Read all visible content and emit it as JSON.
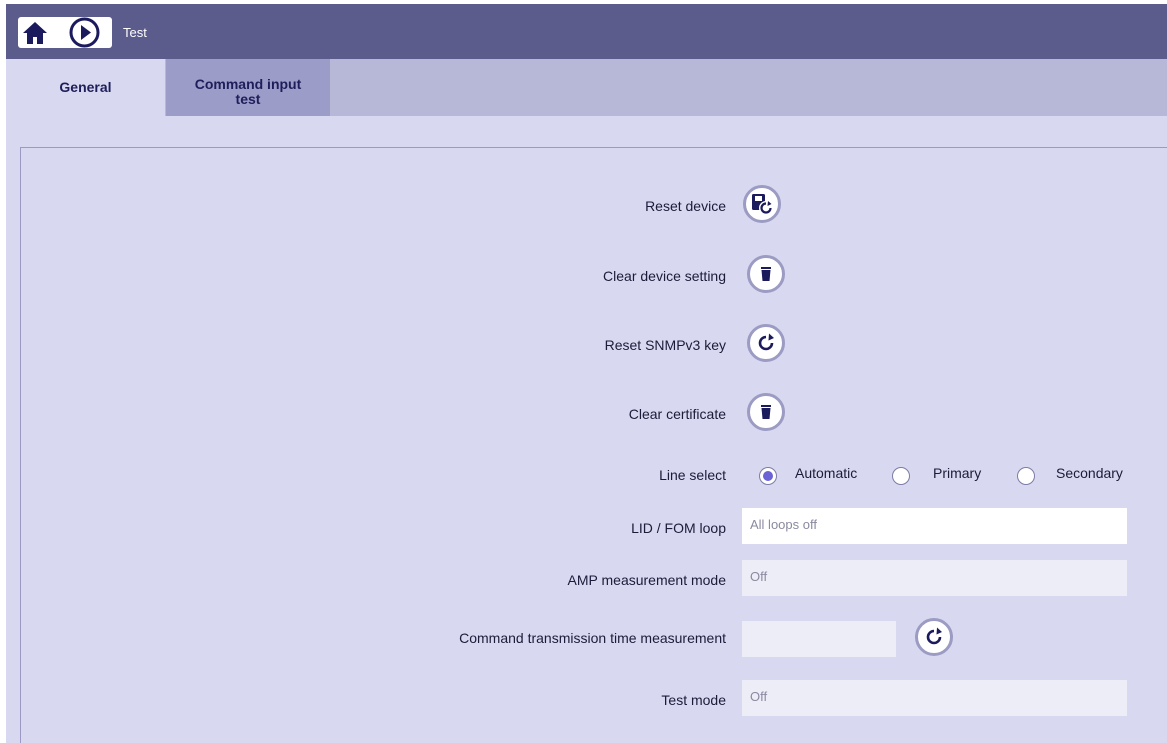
{
  "header": {
    "title": "Test"
  },
  "tabs": [
    {
      "label": "General"
    },
    {
      "label_line1": "Command input",
      "label_line2": "test"
    }
  ],
  "rows": {
    "reset_device": {
      "label": "Reset device"
    },
    "clear_device_setting": {
      "label": "Clear device setting"
    },
    "reset_snmpv3": {
      "label": "Reset SNMPv3 key"
    },
    "clear_certificate": {
      "label": "Clear certificate"
    },
    "line_select": {
      "label": "Line select",
      "options": [
        "Automatic",
        "Primary",
        "Secondary"
      ],
      "selected": "Automatic"
    },
    "lid_fom": {
      "label": "LID / FOM loop",
      "value": "All loops off"
    },
    "amp_mode": {
      "label": "AMP measurement mode",
      "value": "Off"
    },
    "cmd_time": {
      "label": "Command transmission time measurement",
      "value": ""
    },
    "test_mode": {
      "label": "Test mode",
      "value": "Off"
    }
  },
  "colors": {
    "header": "#5b5b8c",
    "tabbar": "#b7b7d8",
    "background": "#d8d8f0",
    "accent": "#6b62d6"
  }
}
